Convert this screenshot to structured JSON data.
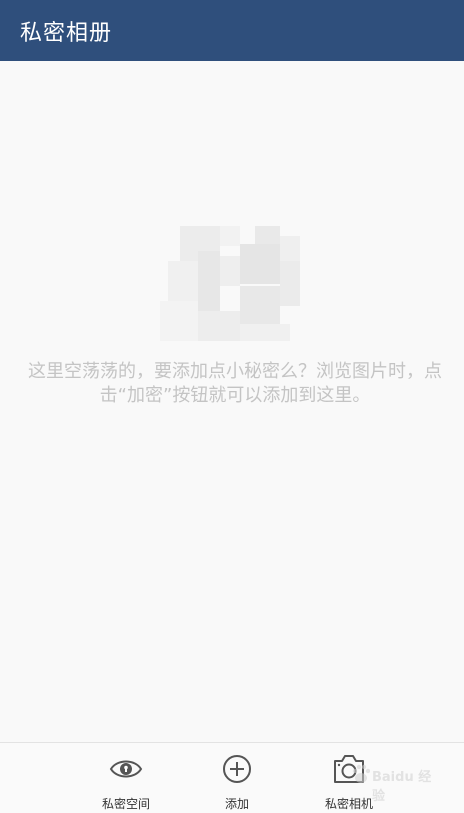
{
  "header": {
    "title": "私密相册"
  },
  "empty_state": {
    "message": "这里空荡荡的，要添加点小秘密么？浏览图片时，点击“加密”按钮就可以添加到这里。"
  },
  "bottom_bar": {
    "tabs": [
      {
        "label": "私密空间",
        "icon": "eye-icon"
      },
      {
        "label": "添加",
        "icon": "plus-circle-icon"
      },
      {
        "label": "私密相机",
        "icon": "camera-icon"
      }
    ]
  },
  "watermark": {
    "text": "Baidu 经验"
  },
  "colors": {
    "header_bg": "#2f4f7c",
    "page_bg": "#f9f9f9",
    "message_text": "#c4c4c4",
    "tab_label": "#333333"
  }
}
